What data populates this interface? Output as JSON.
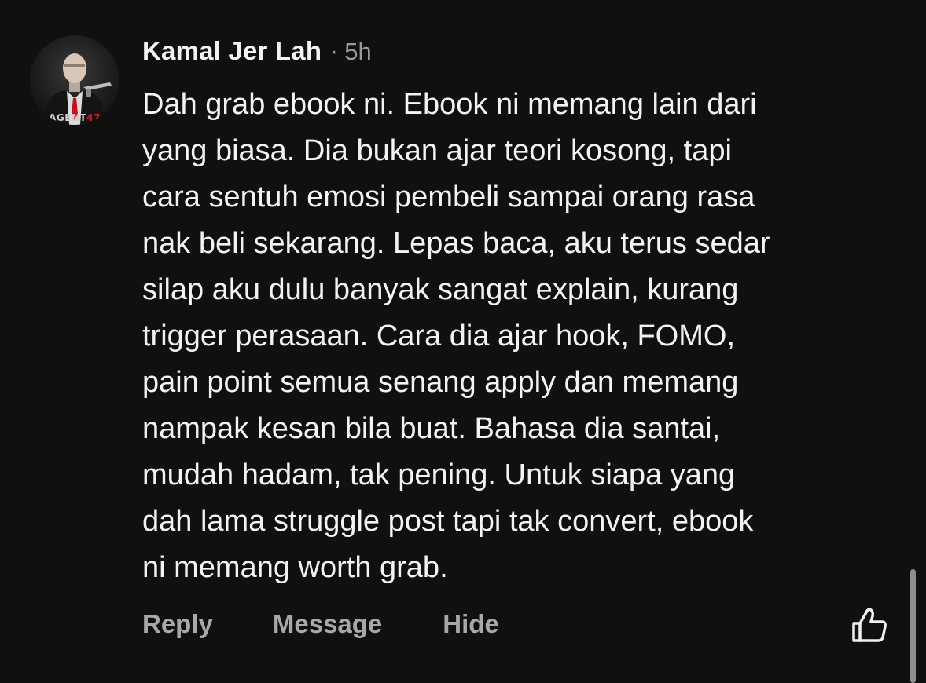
{
  "comment": {
    "author": "Kamal Jer Lah",
    "separator": "·",
    "time": "5h",
    "avatar": {
      "caption_text": "AGENT",
      "caption_number": "47"
    },
    "text": "Dah grab ebook ni. Ebook ni memang lain dari\nyang biasa. Dia bukan ajar teori kosong, tapi\ncara sentuh emosi pembeli sampai orang rasa\nnak beli sekarang. Lepas baca, aku terus sedar\nsilap aku dulu banyak sangat explain, kurang\ntrigger perasaan. Cara dia ajar hook, FOMO,\npain point semua senang apply dan memang\nnampak kesan bila buat. Bahasa dia santai,\nmudah hadam, tak pening. Untuk siapa yang\ndah lama struggle post tapi tak convert, ebook\nni memang worth grab.",
    "actions": {
      "reply": "Reply",
      "message": "Message",
      "hide": "Hide"
    },
    "like_icon": "thumbs-up-icon"
  },
  "colors": {
    "background": "#101010",
    "text": "#f3f3f3",
    "muted": "#9a9a9a",
    "action": "#a8a8a8",
    "accent_red": "#d21e2a"
  }
}
